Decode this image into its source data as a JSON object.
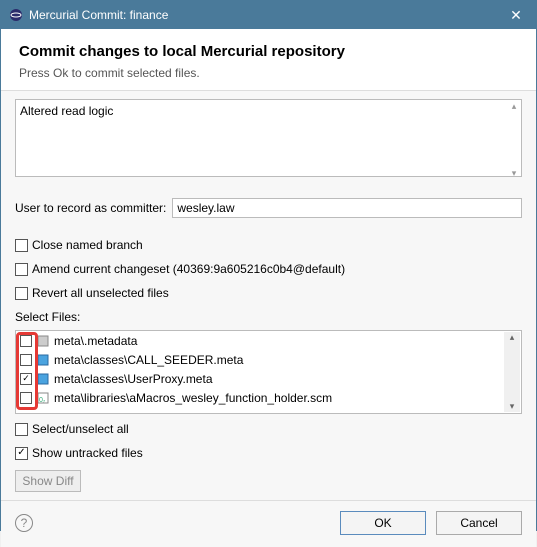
{
  "window": {
    "title": "Mercurial Commit: finance"
  },
  "header": {
    "title": "Commit changes to local Mercurial repository",
    "subtitle": "Press Ok to commit selected files."
  },
  "commit": {
    "message": "Altered read logic"
  },
  "committer": {
    "label": "User to record as committer:",
    "value": "wesley.law"
  },
  "options": {
    "close_branch": "Close named branch",
    "amend": "Amend current changeset (40369:9a605216c0b4@default)",
    "revert": "Revert all unselected files"
  },
  "files": {
    "label": "Select Files:",
    "items": [
      {
        "checked": false,
        "icon": "file-generic",
        "path": "meta\\.metadata"
      },
      {
        "checked": false,
        "icon": "file-meta",
        "path": "meta\\classes\\CALL_SEEDER.meta"
      },
      {
        "checked": true,
        "icon": "file-meta",
        "path": "meta\\classes\\UserProxy.meta"
      },
      {
        "checked": false,
        "icon": "file-scm",
        "path": "meta\\libraries\\aMacros_wesley_function_holder.scm"
      }
    ]
  },
  "bulk": {
    "select_all": "Select/unselect all",
    "show_untracked": "Show untracked files"
  },
  "buttons": {
    "show_diff": "Show Diff",
    "ok": "OK",
    "cancel": "Cancel"
  }
}
